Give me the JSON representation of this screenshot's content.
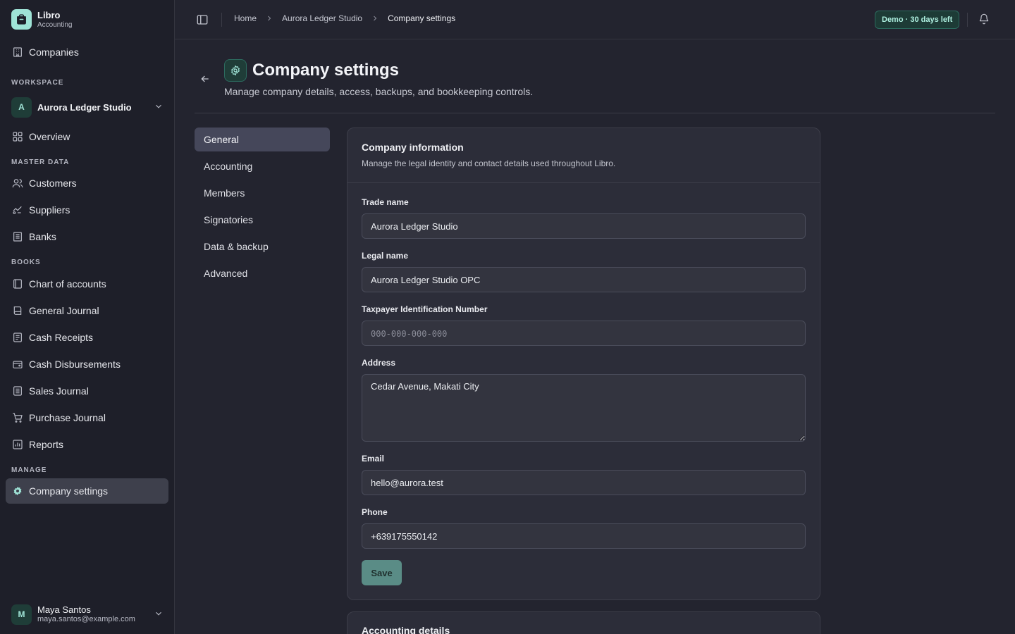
{
  "brand": {
    "name": "Libro",
    "subtitle": "Accounting"
  },
  "sidebar": {
    "companies_label": "Companies",
    "workspace_label": "WORKSPACE",
    "workspace_avatar": "A",
    "workspace_name": "Aurora Ledger Studio",
    "overview_label": "Overview",
    "master_data_label": "MASTER DATA",
    "master_data": [
      "Customers",
      "Suppliers",
      "Banks"
    ],
    "books_label": "BOOKS",
    "books": [
      "Chart of accounts",
      "General Journal",
      "Cash Receipts",
      "Cash Disbursements",
      "Sales Journal",
      "Purchase Journal",
      "Reports"
    ],
    "manage_label": "MANAGE",
    "manage": [
      "Company settings"
    ]
  },
  "user": {
    "avatar": "M",
    "name": "Maya Santos",
    "email": "maya.santos@example.com"
  },
  "breadcrumb": [
    "Home",
    "Aurora Ledger Studio",
    "Company settings"
  ],
  "demo_badge": "Demo · 30 days left",
  "page": {
    "title": "Company settings",
    "description": "Manage company details, access, backups, and bookkeeping controls."
  },
  "subnav": [
    "General",
    "Accounting",
    "Members",
    "Signatories",
    "Data & backup",
    "Advanced"
  ],
  "card": {
    "title": "Company information",
    "description": "Manage the legal identity and contact details used throughout Libro.",
    "fields": {
      "trade_name": {
        "label": "Trade name",
        "value": "Aurora Ledger Studio"
      },
      "legal_name": {
        "label": "Legal name",
        "value": "Aurora Ledger Studio OPC"
      },
      "tin": {
        "label": "Taxpayer Identification Number",
        "value": "",
        "placeholder": "000-000-000-000"
      },
      "address": {
        "label": "Address",
        "value": "Cedar Avenue, Makati City"
      },
      "email": {
        "label": "Email",
        "value": "hello@aurora.test"
      },
      "phone": {
        "label": "Phone",
        "value": "+639175550142"
      }
    },
    "save_label": "Save"
  },
  "card2": {
    "title": "Accounting details"
  },
  "colors": {
    "accent": "#9fe3d6",
    "save_button": "#5a8c86",
    "active_nav": "#3e404c",
    "background": "#23242f"
  }
}
